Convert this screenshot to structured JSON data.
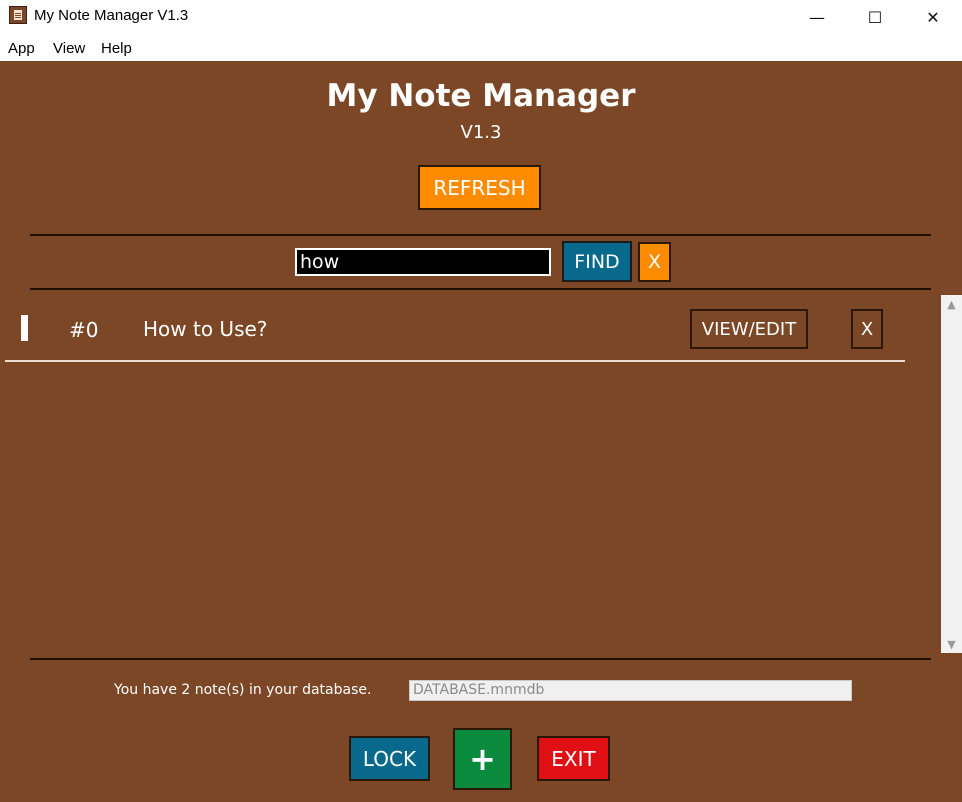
{
  "window": {
    "title": "My Note Manager V1.3",
    "minimize_glyph": "—",
    "maximize_glyph": "☐",
    "close_glyph": "✕"
  },
  "menu": {
    "items": [
      "App",
      "View",
      "Help"
    ]
  },
  "header": {
    "title": "My Note Manager",
    "version": "V1.3",
    "refresh_label": "REFRESH"
  },
  "search": {
    "value": "how",
    "find_label": "FIND",
    "clear_label": "X"
  },
  "notes": [
    {
      "number": "#0",
      "title": "How to Use?",
      "view_label": "VIEW/EDIT",
      "delete_label": "X"
    }
  ],
  "footer": {
    "status": "You have 2 note(s) in your database.",
    "database_file": "DATABASE.mnmdb",
    "lock_label": "LOCK",
    "add_label": "+",
    "exit_label": "EXIT"
  },
  "colors": {
    "background": "#7b4726",
    "orange": "#ff8c00",
    "blue": "#08698c",
    "green": "#0a8a3c",
    "red": "#e00f14",
    "row_button": "#7b4726"
  },
  "icons": {
    "app": "notebook-icon",
    "scroll_up": "chevron-up-icon",
    "scroll_down": "chevron-down-icon"
  }
}
